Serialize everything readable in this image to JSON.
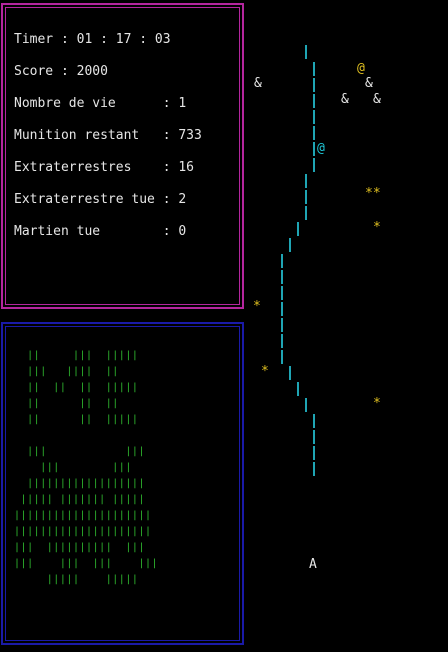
{
  "hud": {
    "timer": "Timer : 01 : 17 : 03",
    "score": "Score : 2000",
    "lives": "Nombre de vie      : 1",
    "ammo": "Munition restant   : 733",
    "aliens": "Extraterrestres    : 16",
    "aliens_killed": "Extraterrestre tue : 2",
    "martians_killed": "Martien tue        : 0"
  },
  "title_art": "  ||     |||  |||||\n  |||   ||||  ||\n  ||  ||  ||  |||||\n  ||      ||  ||\n  ||      ||  |||||\n\n  |||            |||\n    |||        |||\n  ||||||||||||||||||\n ||||| ||||||| |||||\n|||||||||||||||||||||\n|||||||||||||||||||||\n|||  ||||||||||  |||\n|||    |||  |||    |||\n     |||||    |||||",
  "sprites": {
    "enemy_ampersand": "&",
    "enemy_star": "*",
    "enemy_double_star": "**",
    "martian": "@",
    "player_ship": "A"
  },
  "colors": {
    "stats_border": "#b4269e",
    "art_border": "#1a1aa8",
    "art_text": "#2fb82f",
    "laser": "#1fa5b4",
    "star": "#e0c020",
    "text": "#e6e6e6"
  }
}
